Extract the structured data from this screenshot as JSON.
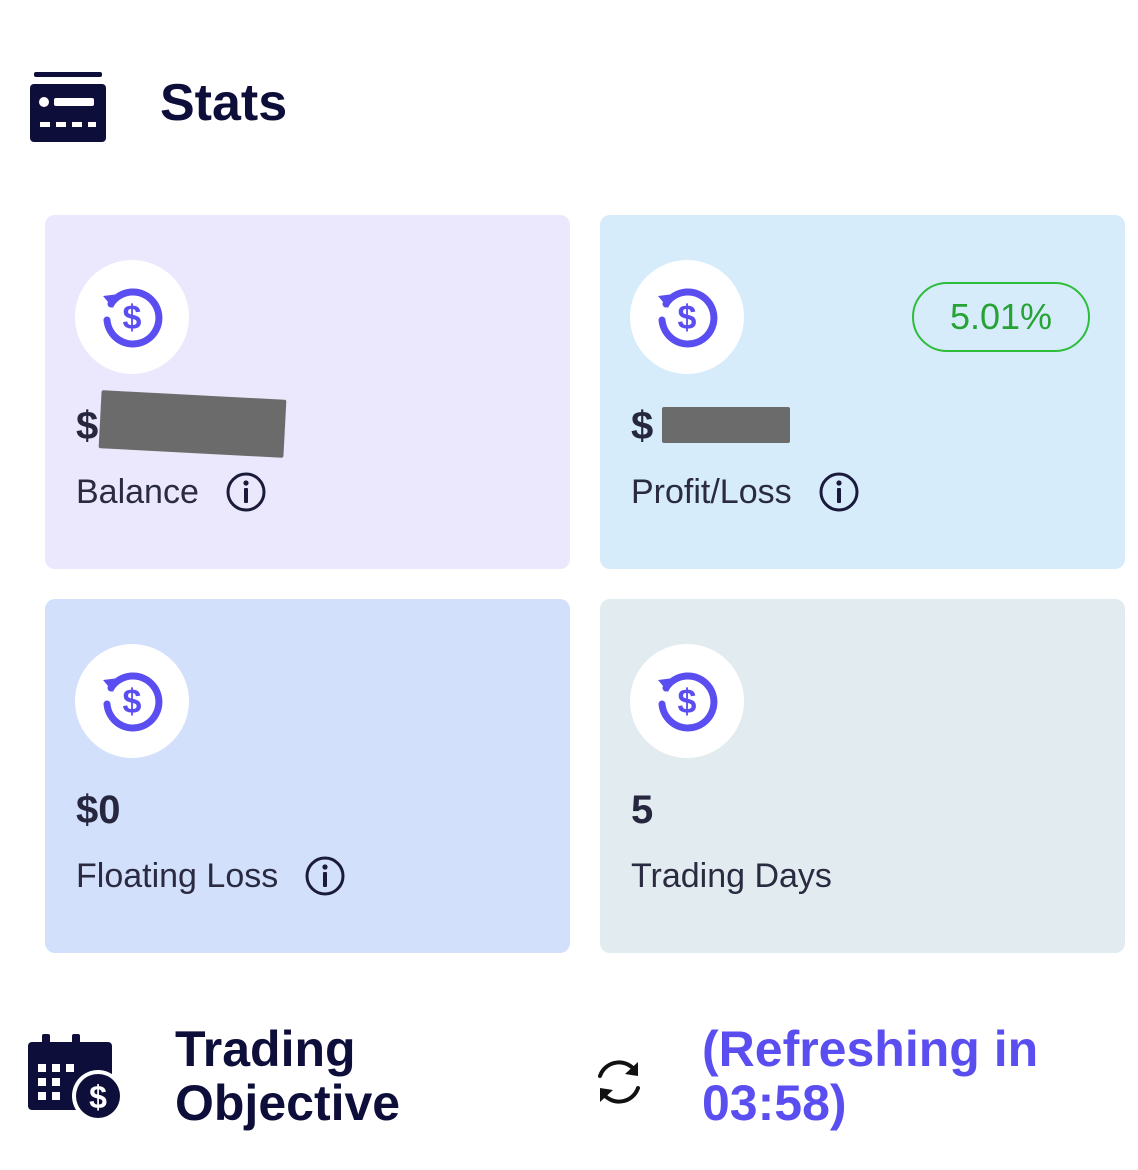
{
  "stats": {
    "title": "Stats"
  },
  "cards": [
    {
      "value": "$",
      "label": "Balance",
      "has_info": true
    },
    {
      "value": "$",
      "label": "Profit/Loss",
      "has_info": true,
      "badge": "5.01%"
    },
    {
      "value": "$0",
      "label": "Floating Loss",
      "has_info": true
    },
    {
      "value": "5",
      "label": "Trading Days",
      "has_info": false
    }
  ],
  "objective": {
    "title_line1": "Trading",
    "title_line2": "Objective",
    "refresh_line1": "(Refreshing in",
    "refresh_line2": "03:58)"
  },
  "colors": {
    "heading": "#0e0e3a",
    "accent": "#5b4ef0",
    "positive": "#27a336",
    "card_balance": "#ebe8fd",
    "card_profit": "#d7ecfb",
    "card_floating": "#d3e0fc",
    "card_days": "#e2ebef"
  },
  "icons": {
    "stats": "stats-card-icon",
    "card": "dollar-refresh-icon",
    "info": "info-icon",
    "objective": "calendar-dollar-icon",
    "refresh": "refresh-icon"
  }
}
